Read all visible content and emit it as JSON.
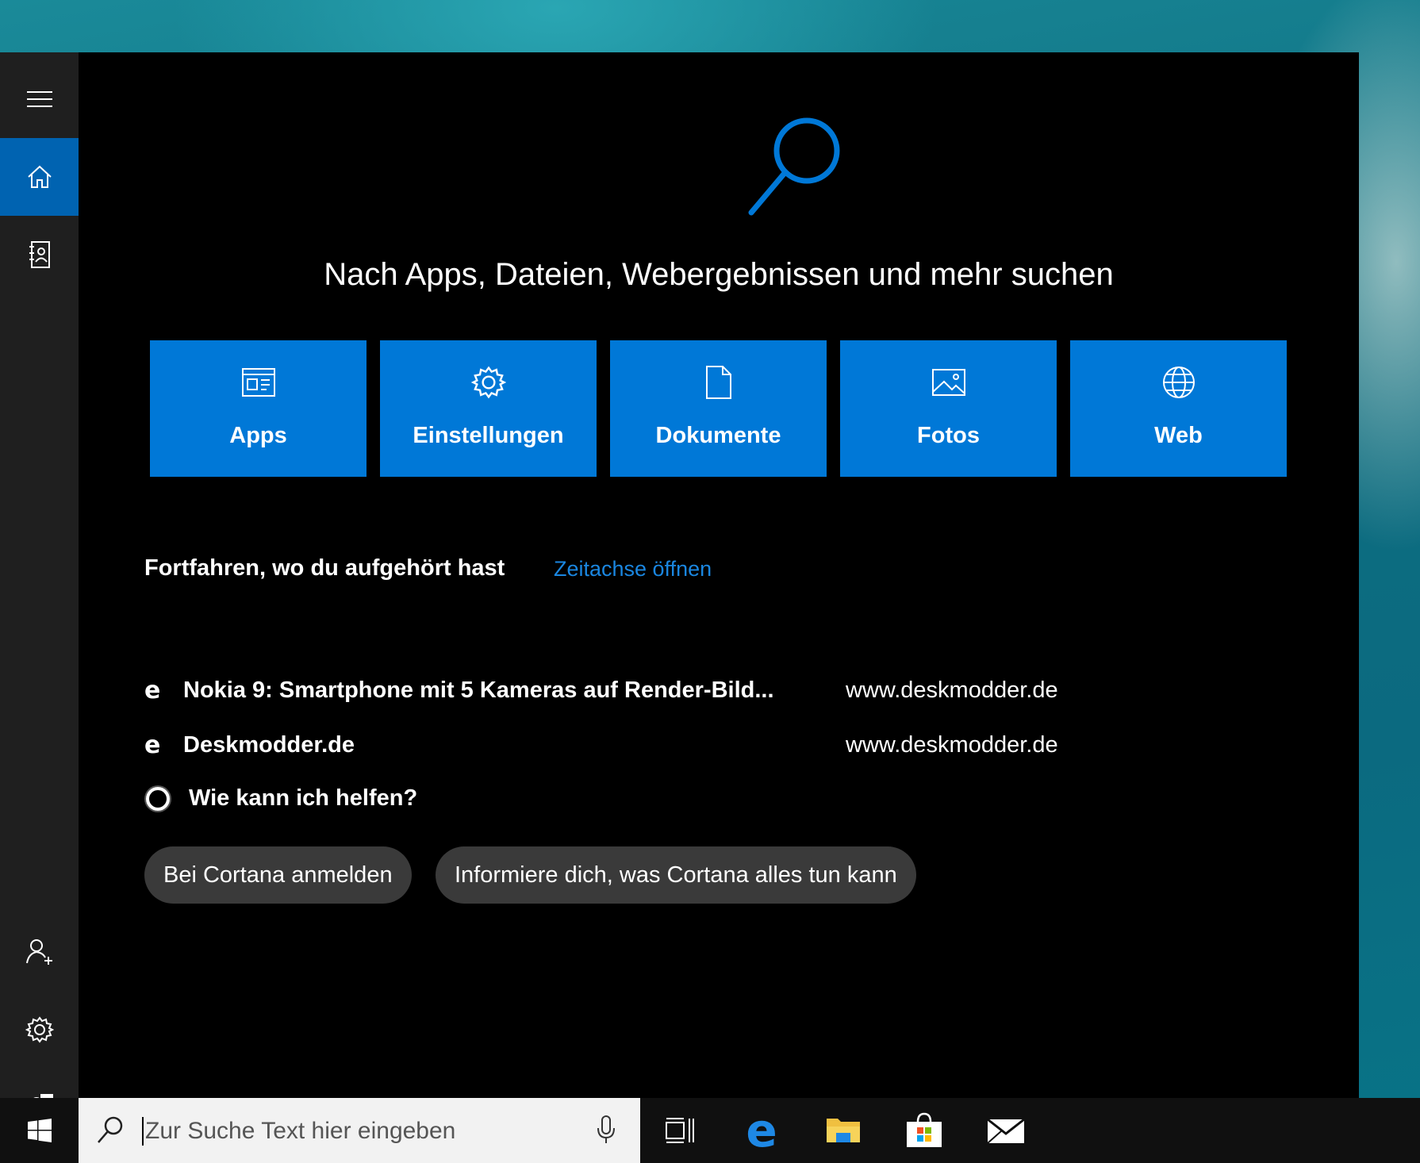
{
  "search_panel": {
    "headline": "Nach Apps, Dateien, Webergebnissen und mehr suchen",
    "categories": [
      {
        "label": "Apps",
        "icon": "apps-icon"
      },
      {
        "label": "Einstellungen",
        "icon": "gear-icon"
      },
      {
        "label": "Dokumente",
        "icon": "document-icon"
      },
      {
        "label": "Fotos",
        "icon": "picture-icon"
      },
      {
        "label": "Web",
        "icon": "globe-icon"
      }
    ],
    "recent": {
      "title": "Fortfahren, wo du aufgehört hast",
      "link": "Zeitachse öffnen",
      "items": [
        {
          "title": "Nokia 9: Smartphone mit 5 Kameras auf Render-Bild...",
          "url": "www.deskmodder.de",
          "icon": "edge-icon"
        },
        {
          "title": "Deskmodder.de",
          "url": "www.deskmodder.de",
          "icon": "edge-icon"
        }
      ]
    },
    "cortana": {
      "question": "Wie kann ich helfen?",
      "buttons": [
        "Bei Cortana anmelden",
        "Informiere dich, was Cortana alles tun kann"
      ]
    }
  },
  "sidebar": {
    "items": [
      {
        "name": "menu",
        "icon": "hamburger-icon"
      },
      {
        "name": "home",
        "icon": "home-icon",
        "active": true
      },
      {
        "name": "notebook",
        "icon": "notebook-icon"
      },
      {
        "name": "account",
        "icon": "add-user-icon"
      },
      {
        "name": "settings",
        "icon": "gear-icon"
      },
      {
        "name": "feedback",
        "icon": "feedback-icon"
      }
    ]
  },
  "taskbar": {
    "search_placeholder": "Zur Suche Text hier eingeben",
    "apps": [
      "task-view-icon",
      "edge-icon",
      "file-explorer-icon",
      "store-icon",
      "mail-icon"
    ]
  },
  "colors": {
    "accent": "#0078d7",
    "active_rail": "#0063b1",
    "link": "#1a86e0",
    "panel_bg": "#000000",
    "rail_bg": "#1f1f1f",
    "pill_bg": "#3a3a3a"
  }
}
